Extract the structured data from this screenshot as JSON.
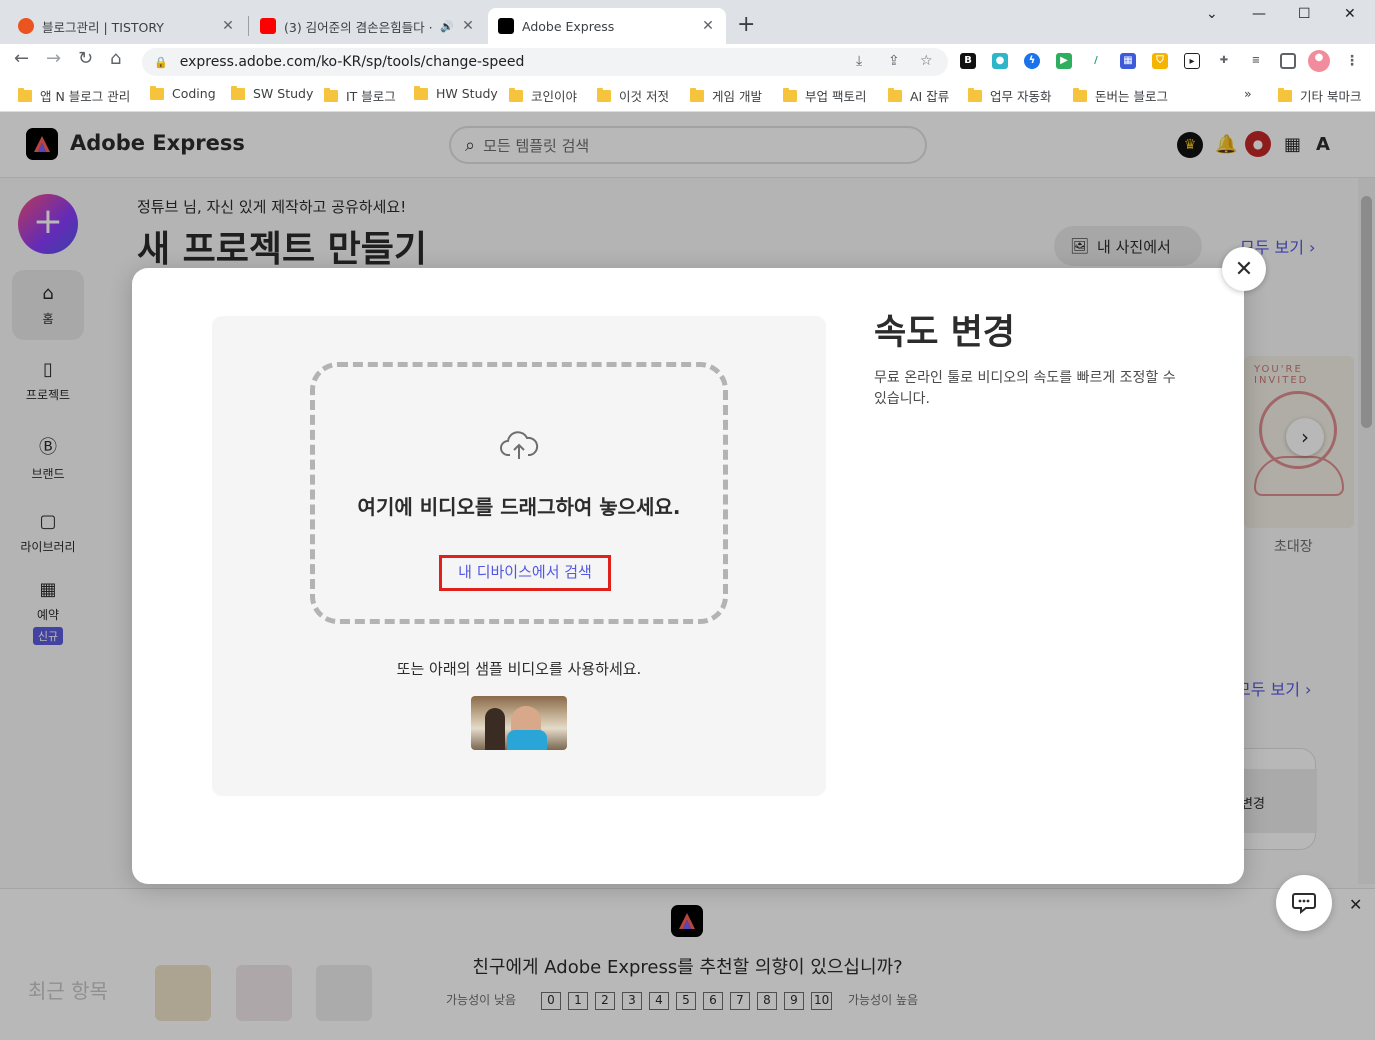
{
  "browser": {
    "tabs": [
      {
        "title": "블로그관리 | TISTORY",
        "favicon_color": "#eb531f"
      },
      {
        "title": "(3) 김어준의 겸손은힘들다 ·",
        "favicon_color": "#ff0000"
      },
      {
        "title": "Adobe Express",
        "favicon_color": "#000000"
      }
    ],
    "url": "express.adobe.com/ko-KR/sp/tools/change-speed",
    "bookmarks": [
      "앱 N 블로그 관리",
      "Coding",
      "SW Study",
      "IT 블로그",
      "HW Study",
      "코인이야",
      "이것 저젓",
      "게임 개발",
      "부업 팩토리",
      "AI 잡류",
      "업무 자동화",
      "돈버는 블로그"
    ],
    "bookmarks_more": "»",
    "other_bookmarks": "기타 북마크"
  },
  "app": {
    "name": "Adobe Express",
    "search_placeholder": "모든 템플릿 검색",
    "rail": [
      {
        "label": "홈",
        "icon": "home-icon"
      },
      {
        "label": "프로젝트",
        "icon": "file-icon"
      },
      {
        "label": "브랜드",
        "icon": "brand-icon"
      },
      {
        "label": "라이브러리",
        "icon": "library-icon"
      },
      {
        "label": "예약",
        "icon": "calendar-icon",
        "badge": "신규"
      }
    ],
    "greeting": "정튜브 님, 자신 있게 제작하고 공유하세요!",
    "heading": "새 프로젝트 만들기",
    "my_photos": "내 사진에서",
    "see_all": "모두 보기",
    "invite_caption": "초대장",
    "card_text": "변경",
    "invite_text": "YOU'RE INVITED"
  },
  "modal": {
    "title": "속도 변경",
    "description": "무료 온라인 툴로 비디오의 속도를 빠르게 조정할 수 있습니다.",
    "drop_text": "여기에 비디오를 드래그하여 놓으세요.",
    "browse_label": "내 디바이스에서 검색",
    "sample_text": "또는 아래의 샘플 비디오를 사용하세요.",
    "close_label": "✕"
  },
  "survey": {
    "question": "친구에게 Adobe Express를 추천할 의향이 있으십니까?",
    "low_label": "가능성이 낮음",
    "high_label": "가능성이 높음",
    "scale": [
      "0",
      "1",
      "2",
      "3",
      "4",
      "5",
      "6",
      "7",
      "8",
      "9",
      "10"
    ],
    "recent_label": "최근 항목"
  },
  "colors": {
    "accent": "#5258e4",
    "highlight": "#e0201b"
  }
}
